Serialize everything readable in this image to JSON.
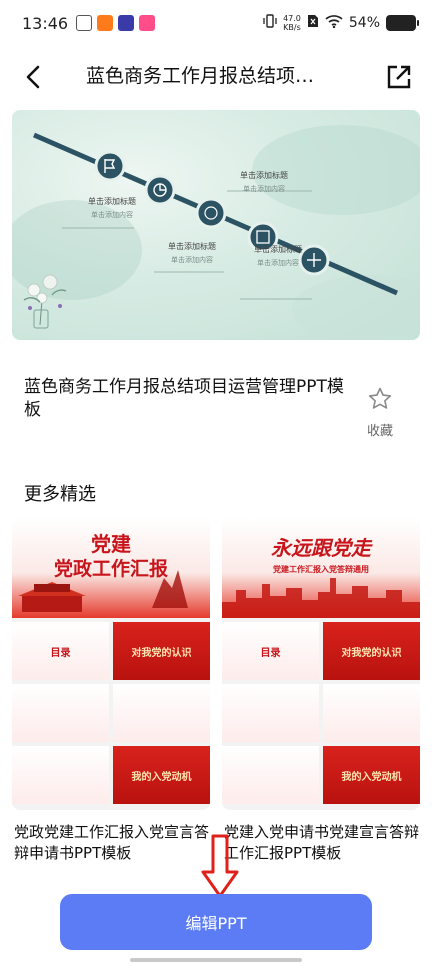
{
  "status_bar": {
    "time": "13:46",
    "net_speed_value": "47.0",
    "net_speed_unit": "KB/s",
    "battery": "54%",
    "app_icon_colors": [
      "#e8e8e8",
      "#ff7a1a",
      "#3a3aa8",
      "#ff4d8a"
    ]
  },
  "header": {
    "title": "蓝色商务工作月报总结项…",
    "back_icon": "chevron-left-icon",
    "share_icon": "share-icon"
  },
  "hero": {
    "nodes": [
      {
        "icon": "flag-icon",
        "heading": "单击添加标题",
        "sub": "单击添加内容"
      },
      {
        "icon": "chart-icon",
        "heading": "单击添加标题",
        "sub": "单击添加内容"
      },
      {
        "icon": "clock-icon",
        "heading": "单击添加标题",
        "sub": "单击添加内容"
      },
      {
        "icon": "document-icon",
        "heading": "单击添加标题",
        "sub": "单击添加内容"
      },
      {
        "icon": "move-icon",
        "heading": "单击添加标题",
        "sub": "单击添加内容"
      }
    ]
  },
  "template": {
    "title": "蓝色商务工作月报总结项目运营管理PPT模板",
    "favorite_label": "收藏",
    "favorite_icon": "star-outline-icon"
  },
  "more": {
    "section_title": "更多精选",
    "cards": [
      {
        "caption": "党政党建工作汇报入党宣言答辩申请书PPT模板",
        "cover_title_1": "党建",
        "cover_title_2": "党政工作汇报",
        "tile_1": "目录",
        "tile_2": "对我党的认识",
        "tile_3": "",
        "tile_4": "",
        "tile_5": "",
        "tile_6": "我的入党动机"
      },
      {
        "caption": "党建入党申请书党建宣言答辩工作汇报PPT模板",
        "cover_title_1": "永远跟党走",
        "cover_title_2": "党建工作汇报入党答辩通用",
        "tile_1": "目录",
        "tile_2": "对我党的认识",
        "tile_3": "",
        "tile_4": "",
        "tile_5": "",
        "tile_6": "我的入党动机"
      }
    ]
  },
  "bottom": {
    "edit_button_label": "编辑PPT"
  },
  "colors": {
    "accent": "#5b7cf4",
    "hero_line": "#2c5363",
    "party_red": "#c8151b",
    "annotation_red": "#e0201a"
  }
}
